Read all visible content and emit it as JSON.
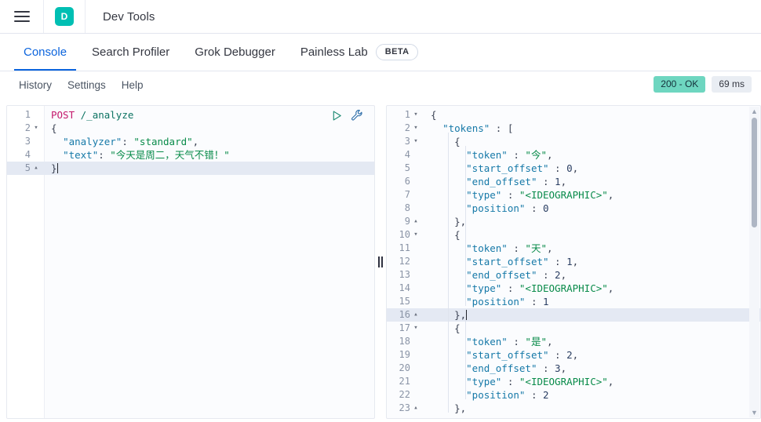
{
  "header": {
    "menu_icon": "hamburger-icon",
    "logo_letter": "D",
    "logo_color": "#00BFB3",
    "title": "Dev Tools"
  },
  "tabs": [
    {
      "label": "Console",
      "active": true
    },
    {
      "label": "Search Profiler",
      "active": false
    },
    {
      "label": "Grok Debugger",
      "active": false
    },
    {
      "label": "Painless Lab",
      "active": false,
      "badge": "BETA"
    }
  ],
  "subbar": {
    "items": [
      "History",
      "Settings",
      "Help"
    ],
    "status": {
      "code": "200 - OK",
      "time": "69 ms",
      "ok_color": "#6ED6C0"
    }
  },
  "request_editor": {
    "play_icon": "play-icon",
    "wrench_icon": "wrench-icon",
    "lines": [
      {
        "n": "1",
        "fold": "",
        "hl": false,
        "tokens": [
          {
            "t": "POST",
            "c": "k-method"
          },
          {
            "t": " ",
            "c": "k-punc"
          },
          {
            "t": "/_analyze",
            "c": "k-url"
          }
        ]
      },
      {
        "n": "2",
        "fold": "▾",
        "hl": false,
        "tokens": [
          {
            "t": "{",
            "c": "k-punc"
          }
        ]
      },
      {
        "n": "3",
        "fold": "",
        "hl": false,
        "tokens": [
          {
            "t": "  ",
            "c": "k-punc"
          },
          {
            "t": "\"analyzer\"",
            "c": "k-key"
          },
          {
            "t": ": ",
            "c": "k-punc"
          },
          {
            "t": "\"standard\"",
            "c": "k-str"
          },
          {
            "t": ",",
            "c": "k-punc"
          }
        ]
      },
      {
        "n": "4",
        "fold": "",
        "hl": false,
        "tokens": [
          {
            "t": "  ",
            "c": "k-punc"
          },
          {
            "t": "\"text\"",
            "c": "k-key"
          },
          {
            "t": ": ",
            "c": "k-punc"
          },
          {
            "t": "\"今天是周二，天气不错！\"",
            "c": "k-str"
          }
        ]
      },
      {
        "n": "5",
        "fold": "▴",
        "hl": true,
        "tokens": [
          {
            "t": "}",
            "c": "k-punc"
          }
        ],
        "caret": true
      }
    ]
  },
  "response_editor": {
    "lines": [
      {
        "n": "1",
        "fold": "▾",
        "hl": false,
        "indent": 0,
        "tokens": [
          {
            "t": "{",
            "c": "k-punc"
          }
        ]
      },
      {
        "n": "2",
        "fold": "▾",
        "hl": false,
        "indent": 0,
        "tokens": [
          {
            "t": "  ",
            "c": "k-punc"
          },
          {
            "t": "\"tokens\"",
            "c": "k-key"
          },
          {
            "t": " : ",
            "c": "k-punc"
          },
          {
            "t": "[",
            "c": "k-punc"
          }
        ]
      },
      {
        "n": "3",
        "fold": "▾",
        "hl": false,
        "indent": 1,
        "tokens": [
          {
            "t": "    ",
            "c": "k-punc"
          },
          {
            "t": "{",
            "c": "k-punc"
          }
        ]
      },
      {
        "n": "4",
        "fold": "",
        "hl": false,
        "indent": 2,
        "tokens": [
          {
            "t": "      ",
            "c": "k-punc"
          },
          {
            "t": "\"token\"",
            "c": "k-key"
          },
          {
            "t": " : ",
            "c": "k-punc"
          },
          {
            "t": "\"今\"",
            "c": "k-str"
          },
          {
            "t": ",",
            "c": "k-punc"
          }
        ]
      },
      {
        "n": "5",
        "fold": "",
        "hl": false,
        "indent": 2,
        "tokens": [
          {
            "t": "      ",
            "c": "k-punc"
          },
          {
            "t": "\"start_offset\"",
            "c": "k-key"
          },
          {
            "t": " : ",
            "c": "k-punc"
          },
          {
            "t": "0",
            "c": "k-num"
          },
          {
            "t": ",",
            "c": "k-punc"
          }
        ]
      },
      {
        "n": "6",
        "fold": "",
        "hl": false,
        "indent": 2,
        "tokens": [
          {
            "t": "      ",
            "c": "k-punc"
          },
          {
            "t": "\"end_offset\"",
            "c": "k-key"
          },
          {
            "t": " : ",
            "c": "k-punc"
          },
          {
            "t": "1",
            "c": "k-num"
          },
          {
            "t": ",",
            "c": "k-punc"
          }
        ]
      },
      {
        "n": "7",
        "fold": "",
        "hl": false,
        "indent": 2,
        "tokens": [
          {
            "t": "      ",
            "c": "k-punc"
          },
          {
            "t": "\"type\"",
            "c": "k-key"
          },
          {
            "t": " : ",
            "c": "k-punc"
          },
          {
            "t": "\"<IDEOGRAPHIC>\"",
            "c": "k-str"
          },
          {
            "t": ",",
            "c": "k-punc"
          }
        ]
      },
      {
        "n": "8",
        "fold": "",
        "hl": false,
        "indent": 2,
        "tokens": [
          {
            "t": "      ",
            "c": "k-punc"
          },
          {
            "t": "\"position\"",
            "c": "k-key"
          },
          {
            "t": " : ",
            "c": "k-punc"
          },
          {
            "t": "0",
            "c": "k-num"
          }
        ]
      },
      {
        "n": "9",
        "fold": "▴",
        "hl": false,
        "indent": 1,
        "tokens": [
          {
            "t": "    ",
            "c": "k-punc"
          },
          {
            "t": "},",
            "c": "k-punc"
          }
        ]
      },
      {
        "n": "10",
        "fold": "▾",
        "hl": false,
        "indent": 1,
        "tokens": [
          {
            "t": "    ",
            "c": "k-punc"
          },
          {
            "t": "{",
            "c": "k-punc"
          }
        ]
      },
      {
        "n": "11",
        "fold": "",
        "hl": false,
        "indent": 2,
        "tokens": [
          {
            "t": "      ",
            "c": "k-punc"
          },
          {
            "t": "\"token\"",
            "c": "k-key"
          },
          {
            "t": " : ",
            "c": "k-punc"
          },
          {
            "t": "\"天\"",
            "c": "k-str"
          },
          {
            "t": ",",
            "c": "k-punc"
          }
        ]
      },
      {
        "n": "12",
        "fold": "",
        "hl": false,
        "indent": 2,
        "tokens": [
          {
            "t": "      ",
            "c": "k-punc"
          },
          {
            "t": "\"start_offset\"",
            "c": "k-key"
          },
          {
            "t": " : ",
            "c": "k-punc"
          },
          {
            "t": "1",
            "c": "k-num"
          },
          {
            "t": ",",
            "c": "k-punc"
          }
        ]
      },
      {
        "n": "13",
        "fold": "",
        "hl": false,
        "indent": 2,
        "tokens": [
          {
            "t": "      ",
            "c": "k-punc"
          },
          {
            "t": "\"end_offset\"",
            "c": "k-key"
          },
          {
            "t": " : ",
            "c": "k-punc"
          },
          {
            "t": "2",
            "c": "k-num"
          },
          {
            "t": ",",
            "c": "k-punc"
          }
        ]
      },
      {
        "n": "14",
        "fold": "",
        "hl": false,
        "indent": 2,
        "tokens": [
          {
            "t": "      ",
            "c": "k-punc"
          },
          {
            "t": "\"type\"",
            "c": "k-key"
          },
          {
            "t": " : ",
            "c": "k-punc"
          },
          {
            "t": "\"<IDEOGRAPHIC>\"",
            "c": "k-str"
          },
          {
            "t": ",",
            "c": "k-punc"
          }
        ]
      },
      {
        "n": "15",
        "fold": "",
        "hl": false,
        "indent": 2,
        "tokens": [
          {
            "t": "      ",
            "c": "k-punc"
          },
          {
            "t": "\"position\"",
            "c": "k-key"
          },
          {
            "t": " : ",
            "c": "k-punc"
          },
          {
            "t": "1",
            "c": "k-num"
          }
        ]
      },
      {
        "n": "16",
        "fold": "▴",
        "hl": true,
        "indent": 1,
        "tokens": [
          {
            "t": "    ",
            "c": "k-punc"
          },
          {
            "t": "},",
            "c": "k-punc"
          }
        ],
        "caret": true
      },
      {
        "n": "17",
        "fold": "▾",
        "hl": false,
        "indent": 1,
        "tokens": [
          {
            "t": "    ",
            "c": "k-punc"
          },
          {
            "t": "{",
            "c": "k-punc"
          }
        ]
      },
      {
        "n": "18",
        "fold": "",
        "hl": false,
        "indent": 2,
        "tokens": [
          {
            "t": "      ",
            "c": "k-punc"
          },
          {
            "t": "\"token\"",
            "c": "k-key"
          },
          {
            "t": " : ",
            "c": "k-punc"
          },
          {
            "t": "\"是\"",
            "c": "k-str"
          },
          {
            "t": ",",
            "c": "k-punc"
          }
        ]
      },
      {
        "n": "19",
        "fold": "",
        "hl": false,
        "indent": 2,
        "tokens": [
          {
            "t": "      ",
            "c": "k-punc"
          },
          {
            "t": "\"start_offset\"",
            "c": "k-key"
          },
          {
            "t": " : ",
            "c": "k-punc"
          },
          {
            "t": "2",
            "c": "k-num"
          },
          {
            "t": ",",
            "c": "k-punc"
          }
        ]
      },
      {
        "n": "20",
        "fold": "",
        "hl": false,
        "indent": 2,
        "tokens": [
          {
            "t": "      ",
            "c": "k-punc"
          },
          {
            "t": "\"end_offset\"",
            "c": "k-key"
          },
          {
            "t": " : ",
            "c": "k-punc"
          },
          {
            "t": "3",
            "c": "k-num"
          },
          {
            "t": ",",
            "c": "k-punc"
          }
        ]
      },
      {
        "n": "21",
        "fold": "",
        "hl": false,
        "indent": 2,
        "tokens": [
          {
            "t": "      ",
            "c": "k-punc"
          },
          {
            "t": "\"type\"",
            "c": "k-key"
          },
          {
            "t": " : ",
            "c": "k-punc"
          },
          {
            "t": "\"<IDEOGRAPHIC>\"",
            "c": "k-str"
          },
          {
            "t": ",",
            "c": "k-punc"
          }
        ]
      },
      {
        "n": "22",
        "fold": "",
        "hl": false,
        "indent": 2,
        "tokens": [
          {
            "t": "      ",
            "c": "k-punc"
          },
          {
            "t": "\"position\"",
            "c": "k-key"
          },
          {
            "t": " : ",
            "c": "k-punc"
          },
          {
            "t": "2",
            "c": "k-num"
          }
        ]
      },
      {
        "n": "23",
        "fold": "▴",
        "hl": false,
        "indent": 1,
        "tokens": [
          {
            "t": "    ",
            "c": "k-punc"
          },
          {
            "t": "},",
            "c": "k-punc"
          }
        ]
      }
    ],
    "scrollbar": {
      "up_arrow": "▲",
      "down_arrow": "▼"
    }
  },
  "splitter": {
    "grip_icon": "resize-grip-icon"
  }
}
